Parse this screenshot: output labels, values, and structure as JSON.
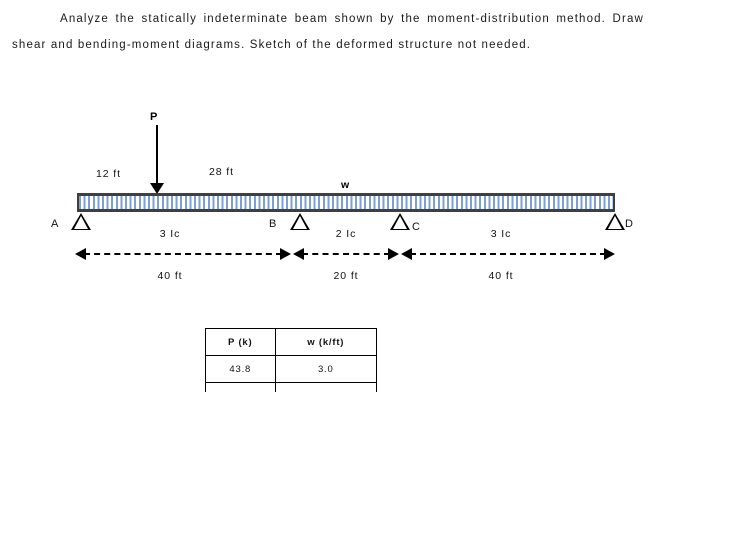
{
  "problem": {
    "text": "Analyze the statically indeterminate beam shown by the moment-distribution method. Draw shear and bending-moment diagrams. Sketch of the deformed structure not needed."
  },
  "figure": {
    "point_load": {
      "label": "P",
      "icon": "down-arrow-icon"
    },
    "distributed_load": {
      "label": "w",
      "icon": "uniform-load-hatch-icon"
    },
    "load_positions": [
      {
        "name": "distance-to-load",
        "label": "12 ft"
      },
      {
        "name": "load-to-support-b",
        "label": "28 ft"
      }
    ],
    "supports": [
      {
        "id": "A",
        "label": "A"
      },
      {
        "id": "B",
        "label": "B"
      },
      {
        "id": "C",
        "label": "C"
      },
      {
        "id": "D",
        "label": "D"
      }
    ],
    "spans": [
      {
        "name": "span-ab",
        "stiffness": "3 Ic",
        "length": "40 ft"
      },
      {
        "name": "span-bc",
        "stiffness": "2 Ic",
        "length": "20 ft"
      },
      {
        "name": "span-cd",
        "stiffness": "3 Ic",
        "length": "40 ft"
      }
    ]
  },
  "table": {
    "headers": [
      "P (k)",
      "w (k/ft)"
    ],
    "rows": [
      [
        "43.8",
        "3.0"
      ]
    ]
  },
  "colors": {
    "hatch": "#7d9fd4",
    "beam_outline": "#3f3f3f",
    "ink": "#000000"
  }
}
